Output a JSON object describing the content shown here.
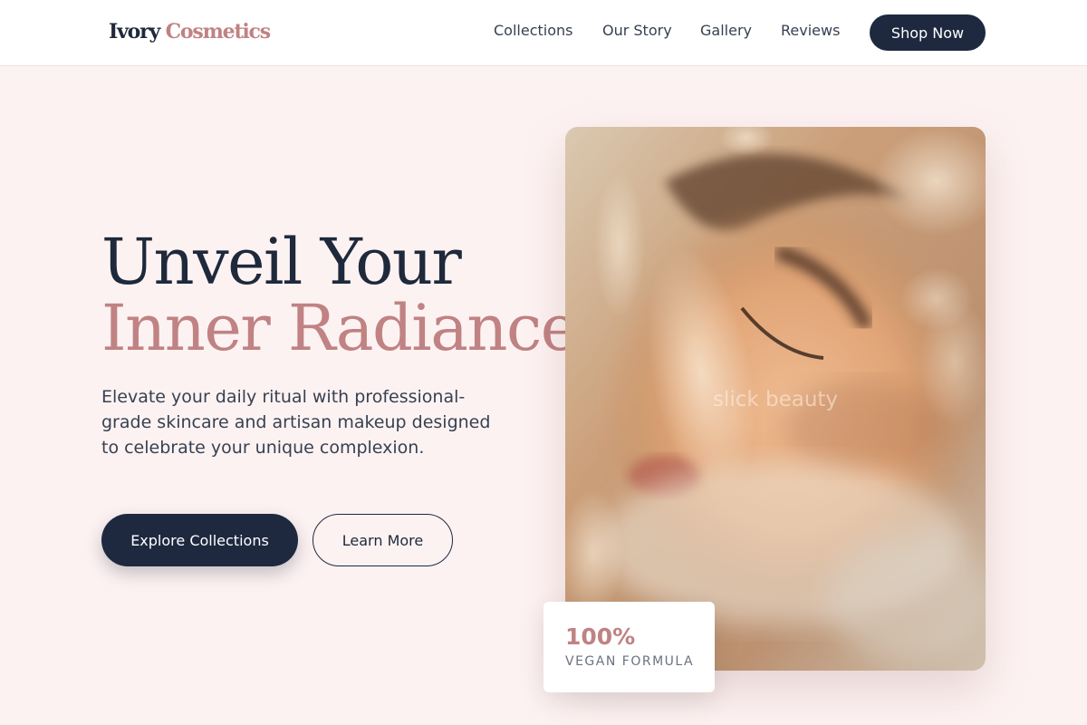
{
  "header": {
    "logo_primary": "Ivory",
    "logo_accent": "Cosmetics",
    "nav": [
      "Collections",
      "Our Story",
      "Gallery",
      "Reviews"
    ],
    "cta_label": "Shop Now"
  },
  "hero": {
    "headline_line1": "Unveil Your",
    "headline_line2": "Inner Radiance.",
    "description": "Elevate your daily ritual with professional-grade skincare and artisan makeup designed to celebrate your unique complexion.",
    "primary_button": "Explore Collections",
    "secondary_button": "Learn More",
    "image_watermark": "slick beauty"
  },
  "badge": {
    "value": "100%",
    "label": "VEGAN FORMULA"
  },
  "colors": {
    "accent": "#c08283",
    "navy": "#1e2940",
    "background": "#fdf2f2"
  },
  "icons": {
    "hero_image": "portrait-photo"
  }
}
